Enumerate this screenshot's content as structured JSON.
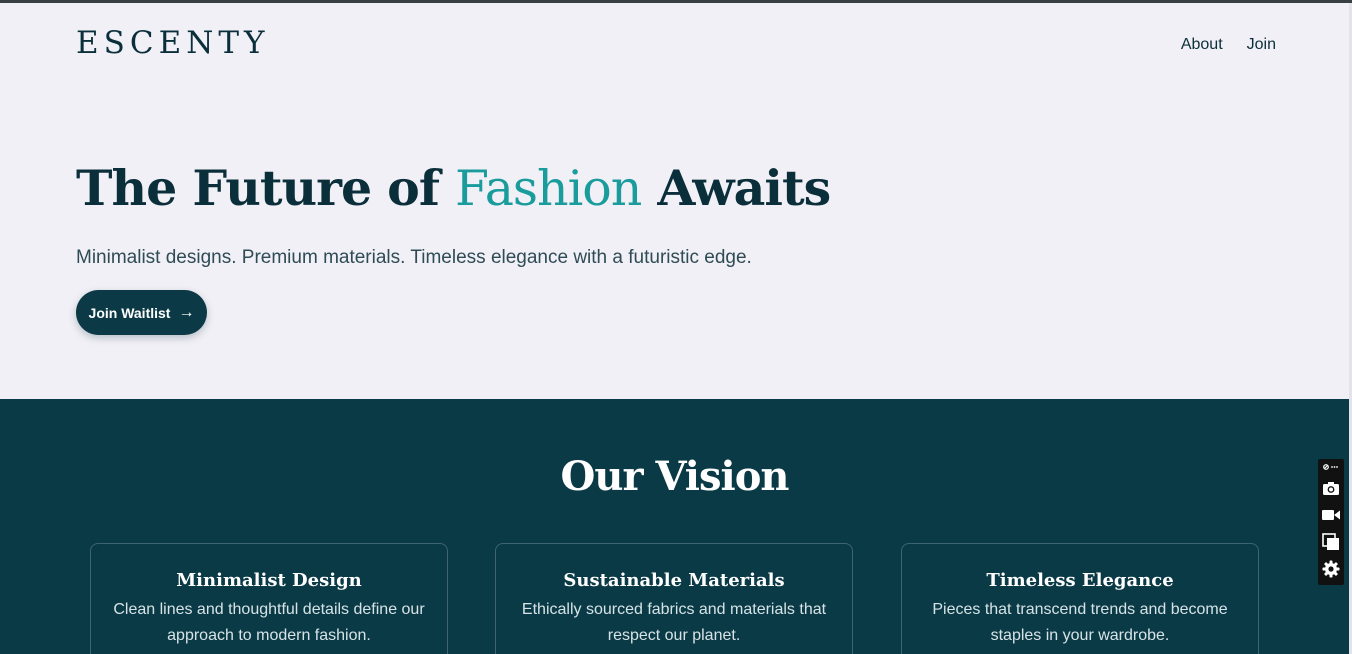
{
  "header": {
    "logo": "ESCENTY",
    "nav": [
      {
        "label": "About"
      },
      {
        "label": "Join"
      }
    ]
  },
  "hero": {
    "title_part1": "The Future of ",
    "title_accent": "Fashion",
    "title_part2": " Awaits",
    "subtitle": "Minimalist designs. Premium materials. Timeless elegance with a futuristic edge.",
    "cta_label": "Join Waitlist",
    "cta_arrow": "→"
  },
  "vision": {
    "title": "Our Vision",
    "cards": [
      {
        "title": "Minimalist Design",
        "text": "Clean lines and thoughtful details define our approach to modern fashion."
      },
      {
        "title": "Sustainable Materials",
        "text": "Ethically sourced fabrics and materials that respect our planet."
      },
      {
        "title": "Timeless Elegance",
        "text": "Pieces that transcend trends and become staples in your wardrobe."
      }
    ]
  },
  "toolbar": {
    "icons": [
      "link-more-icon",
      "camera-icon",
      "video-icon",
      "copy-icon",
      "gear-icon"
    ]
  },
  "colors": {
    "primary": "#0b2f3a",
    "accent": "#1a9c9c",
    "section_bg": "#0b3a47",
    "page_bg": "#f1f0f6"
  }
}
